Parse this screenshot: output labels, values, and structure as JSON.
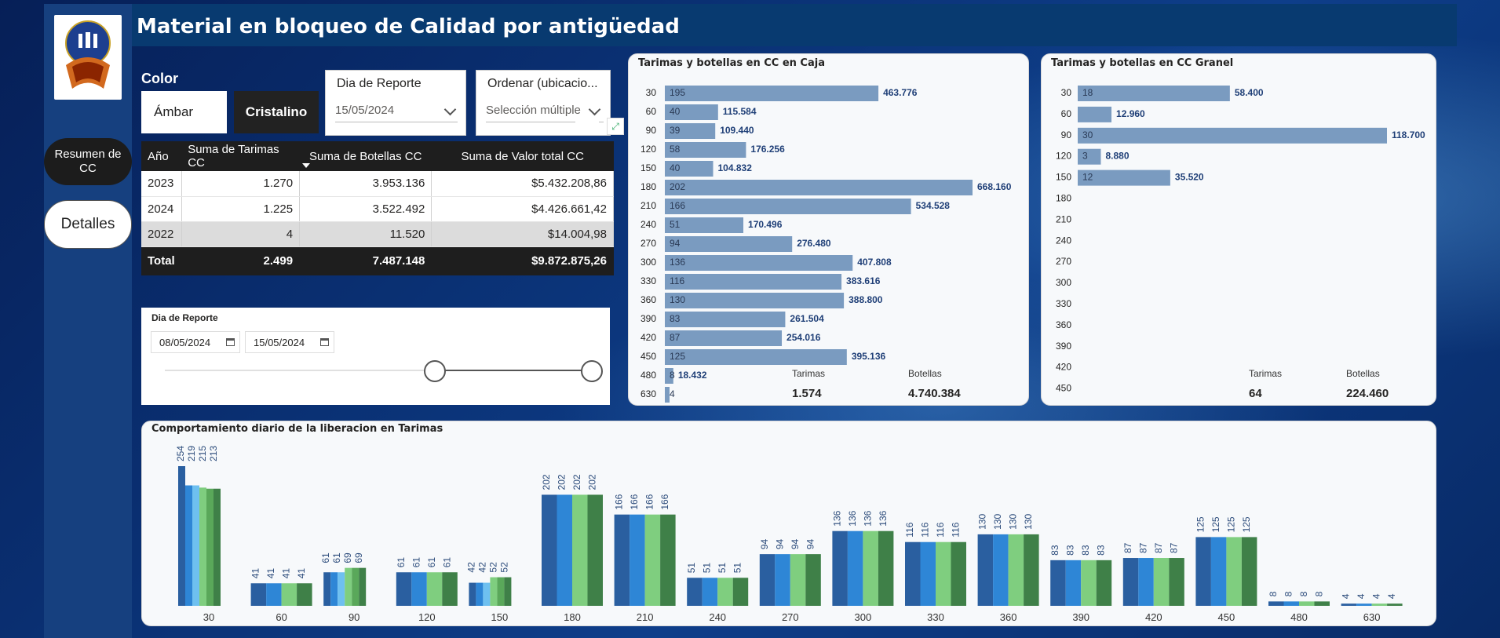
{
  "title": "Material en bloqueo de Calidad por antigüedad",
  "nav": {
    "summary": "Resumen de CC",
    "details": "Detalles"
  },
  "color_filter": {
    "label": "Color",
    "option1": "Ámbar",
    "option2": "Cristalino"
  },
  "report_day": {
    "label": "Dia de Reporte",
    "value": "15/05/2024"
  },
  "sort_by": {
    "label": "Ordenar (ubicacio...",
    "value": "Selección múltiple"
  },
  "table": {
    "headers": [
      "Año",
      "Suma de Tarimas CC",
      "Suma de Botellas CC",
      "Suma de Valor total CC"
    ],
    "rows": [
      [
        "2023",
        "1.270",
        "3.953.136",
        "$5.432.208,86"
      ],
      [
        "2024",
        "1.225",
        "3.522.492",
        "$4.426.661,42"
      ],
      [
        "2022",
        "4",
        "11.520",
        "$14.004,98"
      ]
    ],
    "total": [
      "Total",
      "2.499",
      "7.487.148",
      "$9.872.875,26"
    ]
  },
  "date_range": {
    "label": "Dia de Reporte",
    "start": "08/05/2024",
    "end": "15/05/2024"
  },
  "colors": {
    "bar": "#7a9bc0",
    "label_blue": "#1f3f77",
    "daily": [
      "#2a5fa0",
      "#2e86d6",
      "#6ec0f0",
      "#7fce7f",
      "#5aa85a",
      "#3f8048"
    ]
  },
  "chart_data": [
    {
      "type": "bar",
      "title": "Tarimas y botellas en CC en Caja",
      "categories": [
        "30",
        "60",
        "90",
        "120",
        "150",
        "180",
        "210",
        "240",
        "270",
        "300",
        "330",
        "360",
        "390",
        "420",
        "450",
        "480",
        "630"
      ],
      "series": [
        {
          "name": "Tarimas",
          "values": [
            195,
            40,
            39,
            58,
            40,
            202,
            166,
            51,
            94,
            136,
            116,
            130,
            83,
            87,
            125,
            8,
            4
          ]
        },
        {
          "name": "Botellas",
          "values": [
            463776,
            115584,
            109440,
            176256,
            104832,
            668160,
            534528,
            170496,
            276480,
            407808,
            383616,
            388800,
            261504,
            254016,
            395136,
            18432,
            null
          ]
        }
      ],
      "bar_labels": [
        "195",
        "40",
        "39",
        "58",
        "40",
        "202",
        "166",
        "51",
        "94",
        "136",
        "116",
        "130",
        "83",
        "87",
        "125",
        "8",
        "4"
      ],
      "value_labels": [
        "463.776",
        "115.584",
        "109.440",
        "176.256",
        "104.832",
        "668.160",
        "534.528",
        "170.496",
        "276.480",
        "407.808",
        "383.616",
        "388.800",
        "261.504",
        "254.016",
        "395.136",
        "18.432",
        ""
      ],
      "kpi": {
        "tarimas_label": "Tarimas",
        "tarimas": "1.574",
        "botellas_label": "Botellas",
        "botellas": "4.740.384"
      }
    },
    {
      "type": "bar",
      "title": "Tarimas y botellas en CC Granel",
      "categories": [
        "30",
        "60",
        "90",
        "120",
        "150",
        "180",
        "210",
        "240",
        "270",
        "300",
        "330",
        "360",
        "390",
        "420",
        "450"
      ],
      "series": [
        {
          "name": "Tarimas",
          "values": [
            18,
            null,
            30,
            3,
            12,
            null,
            null,
            null,
            null,
            null,
            null,
            null,
            null,
            null,
            null
          ]
        },
        {
          "name": "Botellas",
          "values": [
            58400,
            12960,
            118700,
            8880,
            35520,
            null,
            null,
            null,
            null,
            null,
            null,
            null,
            null,
            null,
            null
          ]
        }
      ],
      "bar_labels": [
        "18",
        "",
        "30",
        "3",
        "12",
        "",
        "",
        "",
        "",
        "",
        "",
        "",
        "",
        "",
        ""
      ],
      "value_labels": [
        "58.400",
        "12.960",
        "118.700",
        "8.880",
        "35.520",
        "",
        "",
        "",
        "",
        "",
        "",
        "",
        "",
        "",
        ""
      ],
      "kpi": {
        "tarimas_label": "Tarimas",
        "tarimas": "64",
        "botellas_label": "Botellas",
        "botellas": "224.460"
      }
    },
    {
      "type": "bar",
      "title": "Comportamiento diario de la liberacion en Tarimas",
      "categories": [
        "30",
        "60",
        "90",
        "120",
        "150",
        "180",
        "210",
        "240",
        "270",
        "300",
        "330",
        "360",
        "390",
        "420",
        "450",
        "480",
        "630"
      ],
      "series_values": [
        [
          254,
          41,
          61,
          61,
          42,
          202,
          166,
          51,
          94,
          136,
          116,
          130,
          83,
          87,
          125,
          8,
          4
        ],
        [
          219,
          41,
          61,
          61,
          42,
          202,
          166,
          51,
          94,
          136,
          116,
          130,
          83,
          87,
          125,
          8,
          4
        ],
        [
          215,
          41,
          69,
          61,
          52,
          202,
          166,
          51,
          94,
          136,
          116,
          130,
          83,
          87,
          125,
          8,
          4
        ],
        [
          213,
          41,
          69,
          61,
          52,
          202,
          166,
          51,
          94,
          136,
          116,
          130,
          83,
          87,
          125,
          8,
          4
        ]
      ],
      "bars_per_group": [
        6,
        4,
        6,
        4,
        6,
        4,
        4,
        4,
        4,
        4,
        4,
        4,
        4,
        4,
        4,
        4,
        4
      ],
      "ylim": [
        0,
        270
      ]
    }
  ]
}
